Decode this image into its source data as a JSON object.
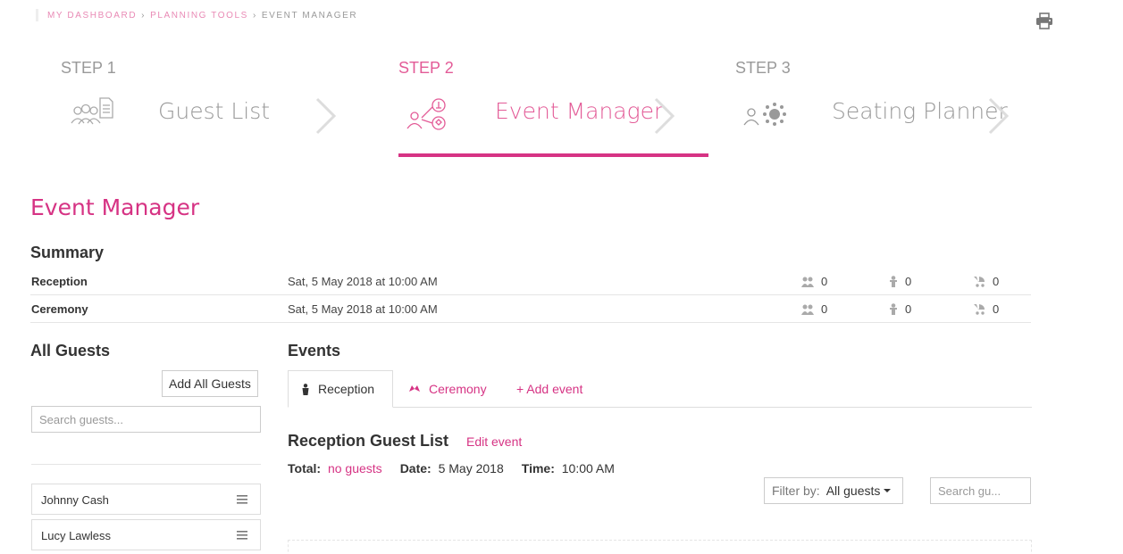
{
  "breadcrumb": {
    "items": [
      "MY DASHBOARD",
      "PLANNING TOOLS",
      "EVENT MANAGER"
    ],
    "separator": "›"
  },
  "steps": [
    {
      "number": "STEP 1",
      "name": "Guest List",
      "active": false
    },
    {
      "number": "STEP 2",
      "name": "Event Manager",
      "active": true
    },
    {
      "number": "STEP 3",
      "name": "Seating Planner",
      "active": false
    }
  ],
  "page_title": "Event Manager",
  "summary": {
    "heading": "Summary",
    "rows": [
      {
        "name": "Reception",
        "when": "Sat, 5 May 2018 at 10:00 AM",
        "adults": "0",
        "children": "0",
        "babies": "0"
      },
      {
        "name": "Ceremony",
        "when": "Sat, 5 May 2018 at 10:00 AM",
        "adults": "0",
        "children": "0",
        "babies": "0"
      }
    ]
  },
  "all_guests": {
    "heading": "All Guests",
    "add_all_label": "Add All Guests",
    "search_placeholder": "Search guests...",
    "guests": [
      "Johnny Cash",
      "Lucy Lawless"
    ]
  },
  "events": {
    "heading": "Events",
    "tabs": [
      {
        "label": "Reception",
        "active": true,
        "icon": "person-icon"
      },
      {
        "label": "Ceremony",
        "active": false,
        "icon": "rings-icon"
      }
    ],
    "add_event_label": "+ Add event",
    "guest_list_title": "Reception Guest List",
    "edit_event_label": "Edit event",
    "total_label": "Total:",
    "total_value": "no guests",
    "date_label": "Date:",
    "date_value": "5 May 2018",
    "time_label": "Time:",
    "time_value": "10:00 AM",
    "filter_label": "Filter by:",
    "filter_value": "All guests",
    "search_placeholder": "Search gu..."
  },
  "colors": {
    "accent": "#d63384",
    "muted": "#999999"
  }
}
